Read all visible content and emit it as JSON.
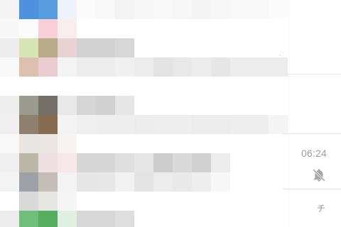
{
  "app": {
    "title": ""
  },
  "right_panel": {
    "time": "06:24",
    "mute_icon": "bell-off-icon",
    "top_fragment": "·",
    "bottom_fragment": "チ"
  },
  "preview": {
    "rows": [
      [
        "#f3f3f3",
        "#4d92dd",
        "#579be0",
        "#eef3fb",
        "#fbfbfb",
        "#f8f8f8",
        "#f3f3f3",
        "#f7f7f7",
        "#f8f8f8",
        "#f6f6f6",
        "#f4f4f4",
        "#f6f6f6",
        "#f8f8f8",
        "#f8f8f8",
        "#fbfbfb"
      ],
      [
        "#f7f7f7",
        "#fbfbfb",
        "#f8cfd8",
        "#f8eef0",
        "#ffffff",
        "#ffffff",
        "#ffffff",
        "#ffffff",
        "#ffffff",
        "#ffffff",
        "#ffffff",
        "#ffffff",
        "#ffffff",
        "#ffffff",
        "#ffffff"
      ],
      [
        "#ededed",
        "#d5e5b4",
        "#b9aa8a",
        "#ead1d3",
        "#d2d2d2",
        "#d2d2d2",
        "#d7d7d7",
        "#ffffff",
        "#ffffff",
        "#ffffff",
        "#ffffff",
        "#ffffff",
        "#ffffff",
        "#ffffff",
        "#ffffff"
      ],
      [
        "#f8f8f8",
        "#ddc0ae",
        "#e9cbd0",
        "#f3f3f3",
        "#ececec",
        "#ececec",
        "#f0f0f0",
        "#ececec",
        "#e3e3e3",
        "#e8e8e8",
        "#ececec",
        "#e6e6e6",
        "#ececec",
        "#ececec",
        "#ececec"
      ],
      [
        "#ffffff",
        "#ffffff",
        "#ffffff",
        "#ffffff",
        "#ffffff",
        "#ffffff",
        "#ffffff",
        "#ffffff",
        "#ffffff",
        "#ffffff",
        "#ffffff",
        "#ffffff",
        "#ffffff",
        "#ffffff",
        "#ffffff"
      ],
      [
        "#eeeeee",
        "#9a9a8f",
        "#747068",
        "#e8e8e8",
        "#d6d6d6",
        "#d1d1d1",
        "#e6e6e6",
        "#ffffff",
        "#ffffff",
        "#ffffff",
        "#ffffff",
        "#ffffff",
        "#ffffff",
        "#ffffff",
        "#ffffff"
      ],
      [
        "#efefef",
        "#8f7f6e",
        "#876c52",
        "#f3f3f3",
        "#efefef",
        "#eeeeee",
        "#eeeeee",
        "#ececec",
        "#eeeeee",
        "#eeeeee",
        "#ececec",
        "#ececec",
        "#eeeeee",
        "#eeeeee",
        "#f4f4f4"
      ],
      [
        "#f8f8f8",
        "#e8e5e3",
        "#ebe5e3",
        "#f8f3f3",
        "#ffffff",
        "#ffffff",
        "#ffffff",
        "#ffffff",
        "#ffffff",
        "#ffffff",
        "#ffffff",
        "#ffffff",
        "#ffffff",
        "#ffffff",
        "#ffffff"
      ],
      [
        "#efefef",
        "#bbb7a6",
        "#f0dfe2",
        "#f8e7ea",
        "#d6d6d6",
        "#d6d6d6",
        "#dedede",
        "#e5e5e5",
        "#cdcdcd",
        "#d9d9d9",
        "#d0d0d0",
        "#ececec",
        "#ffffff",
        "#ffffff",
        "#ffffff"
      ],
      [
        "#f3f3f3",
        "#9da2a8",
        "#c4beb6",
        "#f3f3f3",
        "#e6e6e6",
        "#e7e7e7",
        "#f1f1f1",
        "#e4e4e4",
        "#ececec",
        "#e9e9e9",
        "#eeeeee",
        "#f7f7f7",
        "#ffffff",
        "#ffffff",
        "#ffffff"
      ],
      [
        "#ffffff",
        "#d9d9d9",
        "#e5e5e2",
        "#f5f5f5",
        "#ffffff",
        "#ffffff",
        "#ffffff",
        "#ffffff",
        "#ffffff",
        "#ffffff",
        "#ffffff",
        "#ffffff",
        "#ffffff",
        "#ffffff",
        "#ffffff"
      ],
      [
        "#ececec",
        "#6fbe79",
        "#55ad5f",
        "#dff0e3",
        "#d7d7d7",
        "#d7d7d7",
        "#dedede",
        "#ffffff",
        "#ffffff",
        "#ffffff",
        "#ffffff",
        "#ffffff",
        "#ffffff",
        "#ffffff",
        "#ffffff"
      ]
    ]
  }
}
